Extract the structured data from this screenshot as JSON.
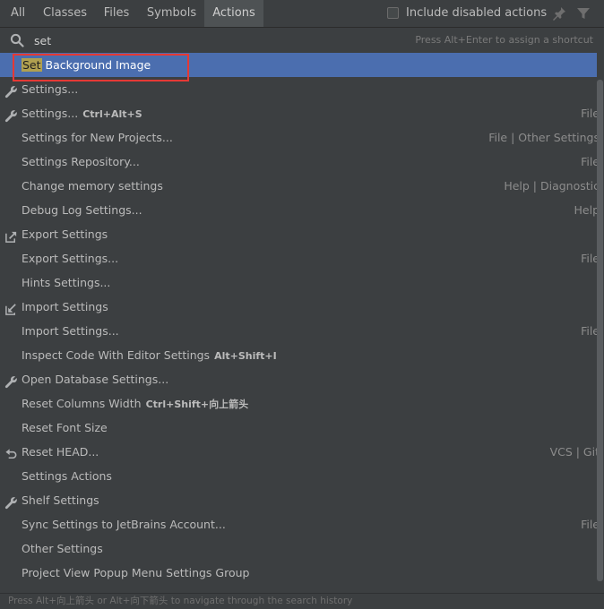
{
  "tabs": [
    {
      "label": "All"
    },
    {
      "label": "Classes"
    },
    {
      "label": "Files"
    },
    {
      "label": "Symbols"
    },
    {
      "label": "Actions",
      "active": true
    }
  ],
  "include_disabled": {
    "label": "Include disabled actions",
    "checked": false
  },
  "search": {
    "value": "set",
    "hint": "Press Alt+Enter to assign a shortcut"
  },
  "results": [
    {
      "match": "Set",
      "rest": " Background Image",
      "shortcut": "",
      "group": "",
      "icon": "",
      "selected": true
    },
    {
      "label": "Settings...",
      "shortcut": "",
      "group": "",
      "icon": "wrench-icon"
    },
    {
      "label": "Settings...",
      "shortcut": "Ctrl+Alt+S",
      "group": "File",
      "icon": "wrench-icon"
    },
    {
      "label": "Settings for New Projects...",
      "shortcut": "",
      "group": "File | Other Settings",
      "icon": ""
    },
    {
      "label": "Settings Repository...",
      "shortcut": "",
      "group": "File",
      "icon": ""
    },
    {
      "label": "Change memory settings",
      "shortcut": "",
      "group": "Help | Diagnostic",
      "icon": ""
    },
    {
      "label": "Debug Log Settings...",
      "shortcut": "",
      "group": "Help",
      "icon": ""
    },
    {
      "label": "Export Settings",
      "shortcut": "",
      "group": "",
      "icon": "export-icon"
    },
    {
      "label": "Export Settings...",
      "shortcut": "",
      "group": "File",
      "icon": ""
    },
    {
      "label": "Hints Settings...",
      "shortcut": "",
      "group": "",
      "icon": ""
    },
    {
      "label": "Import Settings",
      "shortcut": "",
      "group": "",
      "icon": "import-icon"
    },
    {
      "label": "Import Settings...",
      "shortcut": "",
      "group": "File",
      "icon": ""
    },
    {
      "label": "Inspect Code With Editor Settings",
      "shortcut": "Alt+Shift+I",
      "group": "",
      "icon": ""
    },
    {
      "label": "Open Database Settings...",
      "shortcut": "",
      "group": "",
      "icon": "wrench-icon"
    },
    {
      "label": "Reset Columns Width",
      "shortcut": "Ctrl+Shift+向上箭头",
      "group": "",
      "icon": ""
    },
    {
      "label": "Reset Font Size",
      "shortcut": "",
      "group": "",
      "icon": ""
    },
    {
      "label": "Reset HEAD...",
      "shortcut": "",
      "group": "VCS | Git",
      "icon": "undo-icon"
    },
    {
      "label": "Settings Actions",
      "shortcut": "",
      "group": "",
      "icon": ""
    },
    {
      "label": "Shelf Settings",
      "shortcut": "",
      "group": "",
      "icon": "wrench-icon"
    },
    {
      "label": "Sync Settings to JetBrains Account...",
      "shortcut": "",
      "group": "File",
      "icon": ""
    },
    {
      "label": "Other Settings",
      "shortcut": "",
      "group": "",
      "icon": ""
    },
    {
      "label": "Project View Popup Menu Settings Group",
      "shortcut": "",
      "group": "",
      "icon": ""
    }
  ],
  "footer": {
    "text": "Press Alt+向上箭头 or Alt+向下箭头 to navigate through the search history"
  },
  "colors": {
    "background": "#3c3f41",
    "selection": "#4b6eaf",
    "match_highlight": "#b0a050",
    "callout": "#e53935"
  }
}
